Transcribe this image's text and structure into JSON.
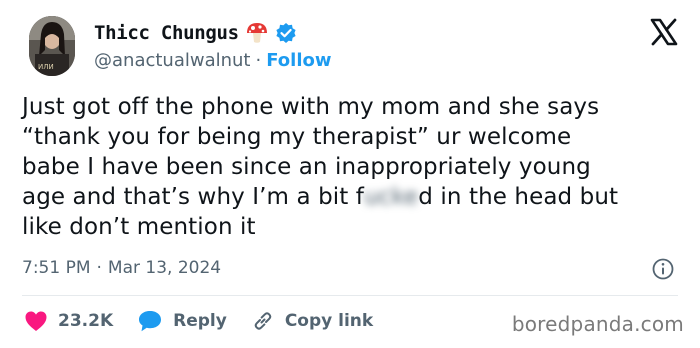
{
  "author": {
    "display_name": "Thicc Chungus",
    "handle": "@anactualwalnut",
    "separator": "·",
    "follow_label": "Follow"
  },
  "tweet": {
    "text_before": "Just got off the phone with my mom and she says\n“thank you for being my therapist” ur welcome\nbabe I have been since an inappropriately young\nage and that’s why I’m a bit f",
    "censored": "ucke",
    "text_after": "d in the head but\nlike don’t mention it",
    "time": "7:51 PM",
    "date_separator": "·",
    "date": "Mar 13, 2024"
  },
  "actions": {
    "likes": "23.2K",
    "reply_label": "Reply",
    "copy_link_label": "Copy link"
  },
  "watermark": "boredpanda.com",
  "icons": {
    "badge": "mushroom-icon",
    "verified": "verified-badge-icon",
    "platform": "x-logo-icon",
    "info": "info-icon",
    "like": "heart-icon",
    "reply": "reply-bubble-icon",
    "copy": "link-icon"
  },
  "colors": {
    "accent": "#1d9bf0",
    "like": "#f91880",
    "text": "#0f1419",
    "muted": "#536471"
  }
}
